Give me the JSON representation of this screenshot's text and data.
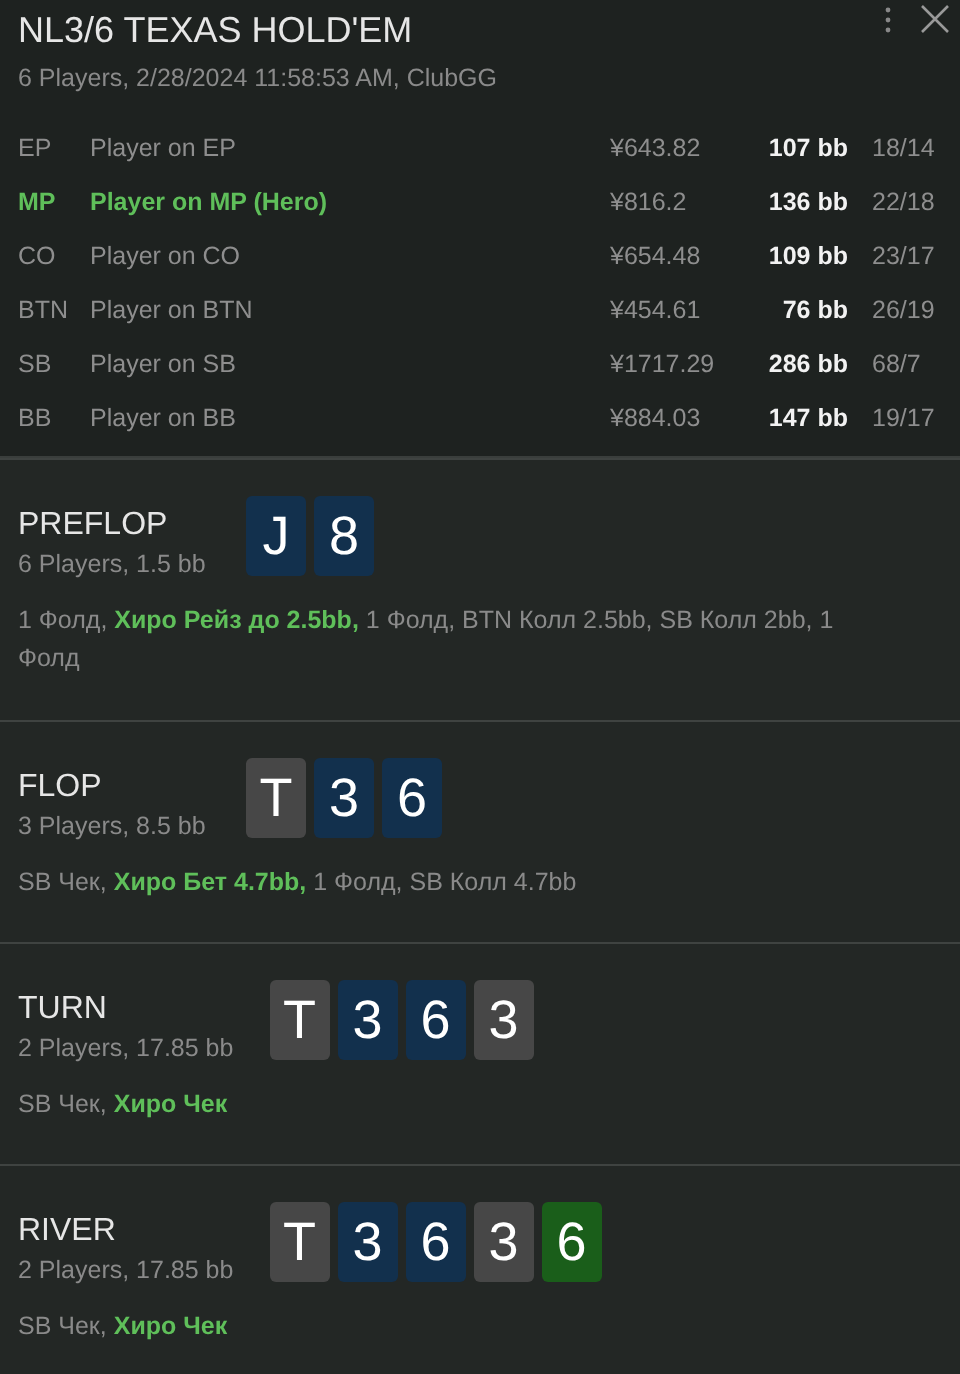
{
  "header": {
    "title": "NL3/6 TEXAS HOLD'EM",
    "subtitle": "6 Players, 2/28/2024 11:58:53 AM, ClubGG"
  },
  "players": [
    {
      "position": "EP",
      "name": "Player on EP",
      "stack": "¥643.82",
      "bb": "107 bb",
      "ratio": "18/14",
      "hero": false
    },
    {
      "position": "MP",
      "name": "Player on MP (Hero)",
      "stack": "¥816.2",
      "bb": "136 bb",
      "ratio": "22/18",
      "hero": true
    },
    {
      "position": "CO",
      "name": "Player on CO",
      "stack": "¥654.48",
      "bb": "109 bb",
      "ratio": "23/17",
      "hero": false
    },
    {
      "position": "BTN",
      "name": "Player on BTN",
      "stack": "¥454.61",
      "bb": "76 bb",
      "ratio": "26/19",
      "hero": false
    },
    {
      "position": "SB",
      "name": "Player on SB",
      "stack": "¥1717.29",
      "bb": "286 bb",
      "ratio": "68/7",
      "hero": false
    },
    {
      "position": "BB",
      "name": "Player on BB",
      "stack": "¥884.03",
      "bb": "147 bb",
      "ratio": "19/17",
      "hero": false
    }
  ],
  "streets": [
    {
      "name": "PREFLOP",
      "info": "6 Players, 1.5 bb",
      "cards": [
        {
          "rank": "J",
          "color": "#12304d"
        },
        {
          "rank": "8",
          "color": "#12304d"
        }
      ],
      "actions": "1 Фолд, **Хиро Рейз до 2.5bb,** 1 Фолд, BTN Колл 2.5bb, SB Колл 2bb, 1 Фолд"
    },
    {
      "name": "FLOP",
      "info": "3 Players, 8.5 bb",
      "cards": [
        {
          "rank": "T",
          "color": "#474747"
        },
        {
          "rank": "3",
          "color": "#12304d"
        },
        {
          "rank": "6",
          "color": "#12304d"
        }
      ],
      "actions": "SB Чек, **Хиро Бет 4.7bb,** 1 Фолд, SB Колл 4.7bb"
    },
    {
      "name": "TURN",
      "info": "2 Players, 17.85 bb",
      "cards": [
        {
          "rank": "T",
          "color": "#474747"
        },
        {
          "rank": "3",
          "color": "#12304d"
        },
        {
          "rank": "6",
          "color": "#12304d"
        },
        {
          "rank": "3",
          "color": "#474747"
        }
      ],
      "actions": "SB Чек, **Хиро Чек**"
    },
    {
      "name": "RIVER",
      "info": "2 Players, 17.85 bb",
      "cards": [
        {
          "rank": "T",
          "color": "#474747"
        },
        {
          "rank": "3",
          "color": "#12304d"
        },
        {
          "rank": "6",
          "color": "#12304d"
        },
        {
          "rank": "3",
          "color": "#474747"
        },
        {
          "rank": "6",
          "color": "#1a5e1a"
        }
      ],
      "actions": "SB Чек, **Хиро Чек**"
    }
  ]
}
